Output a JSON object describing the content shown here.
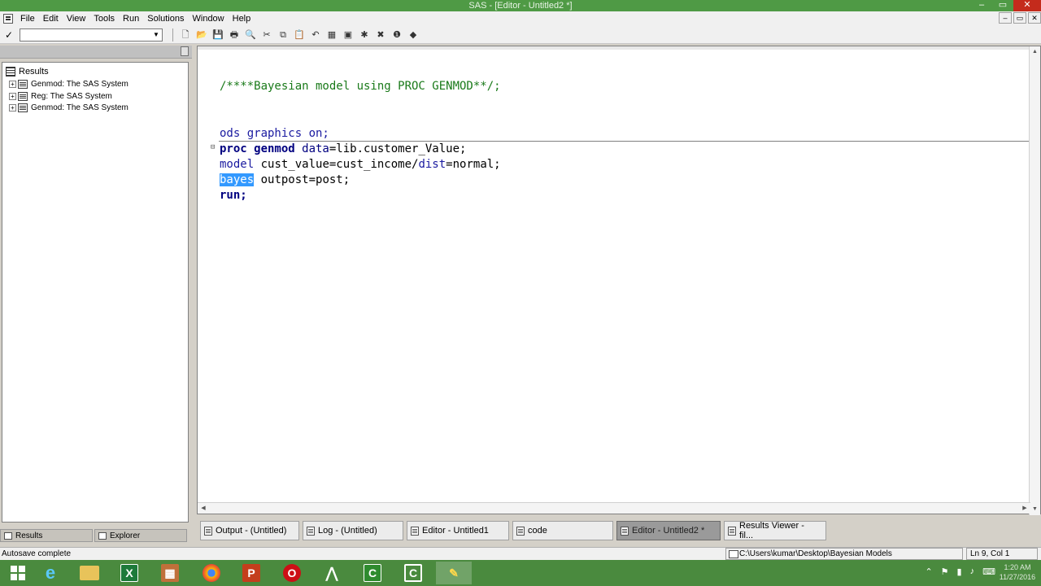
{
  "window": {
    "title": "SAS - [Editor - Untitled2 *]",
    "min": "–",
    "max": "▭",
    "close": "✕"
  },
  "menu": [
    "File",
    "Edit",
    "View",
    "Tools",
    "Run",
    "Solutions",
    "Window",
    "Help"
  ],
  "toolbar": {
    "check_icon": "✓",
    "command_value": "",
    "dropdown_icon": "▼",
    "buttons": [
      "new-icon",
      "open-icon",
      "save-icon",
      "print-icon",
      "print-preview-icon",
      "cut-icon",
      "copy-icon",
      "paste-icon",
      "undo-icon",
      "new-library-icon",
      "submit-icon",
      "clear-icon",
      "break-icon",
      "help-icon"
    ]
  },
  "leftpane": {
    "title": "Results",
    "root": "Results",
    "items": [
      {
        "label": "Genmod:  The SAS System"
      },
      {
        "label": "Reg:  The SAS System"
      },
      {
        "label": "Genmod:  The SAS System"
      }
    ],
    "tabs": [
      "Results",
      "Explorer"
    ]
  },
  "editor": {
    "line_comment": "/****Bayesian model using PROC GENMOD**/;",
    "ods_kw": "ods graphics on;",
    "proc_kw": "proc genmod",
    "proc_opt": " data",
    "proc_rest": "=lib.customer_Value;",
    "model_kw": "model",
    "model_rest": " cust_value=cust_income/",
    "dist_kw": "dist",
    "dist_rest": "=normal;",
    "bayes_sel": "bayes",
    "bayes_rest": " outpost=post;",
    "run_kw": "run;",
    "fold_marker": "⊟"
  },
  "wintabs": [
    {
      "label": "Output - (Untitled)",
      "active": false
    },
    {
      "label": "Log - (Untitled)",
      "active": false
    },
    {
      "label": "Editor - Untitled1",
      "active": false
    },
    {
      "label": "code",
      "active": false
    },
    {
      "label": "Editor - Untitled2 *",
      "active": true
    },
    {
      "label": "Results Viewer - fil...",
      "active": false
    }
  ],
  "status": {
    "message": "Autosave complete",
    "path": "C:\\Users\\kumar\\Desktop\\Bayesian Models",
    "position": "Ln 9, Col 1"
  },
  "taskbar": {
    "apps": [
      "windows-start-icon",
      "internet-explorer-icon",
      "file-explorer-icon",
      "excel-icon",
      "app-icon",
      "chrome-icon",
      "powerpoint-icon",
      "opera-icon",
      "winamp-icon",
      "camtasia-icon",
      "camtasia-recorder-icon",
      "sas-icon"
    ],
    "clock_time": "1:20 AM",
    "clock_date": "11/27/2016"
  },
  "colors": {
    "titlebar": "#4f9a45",
    "taskbar": "#4a8a3e",
    "comment": "#1a7a1a",
    "keyword": "#1a1aa0",
    "selection": "#3399ff"
  }
}
